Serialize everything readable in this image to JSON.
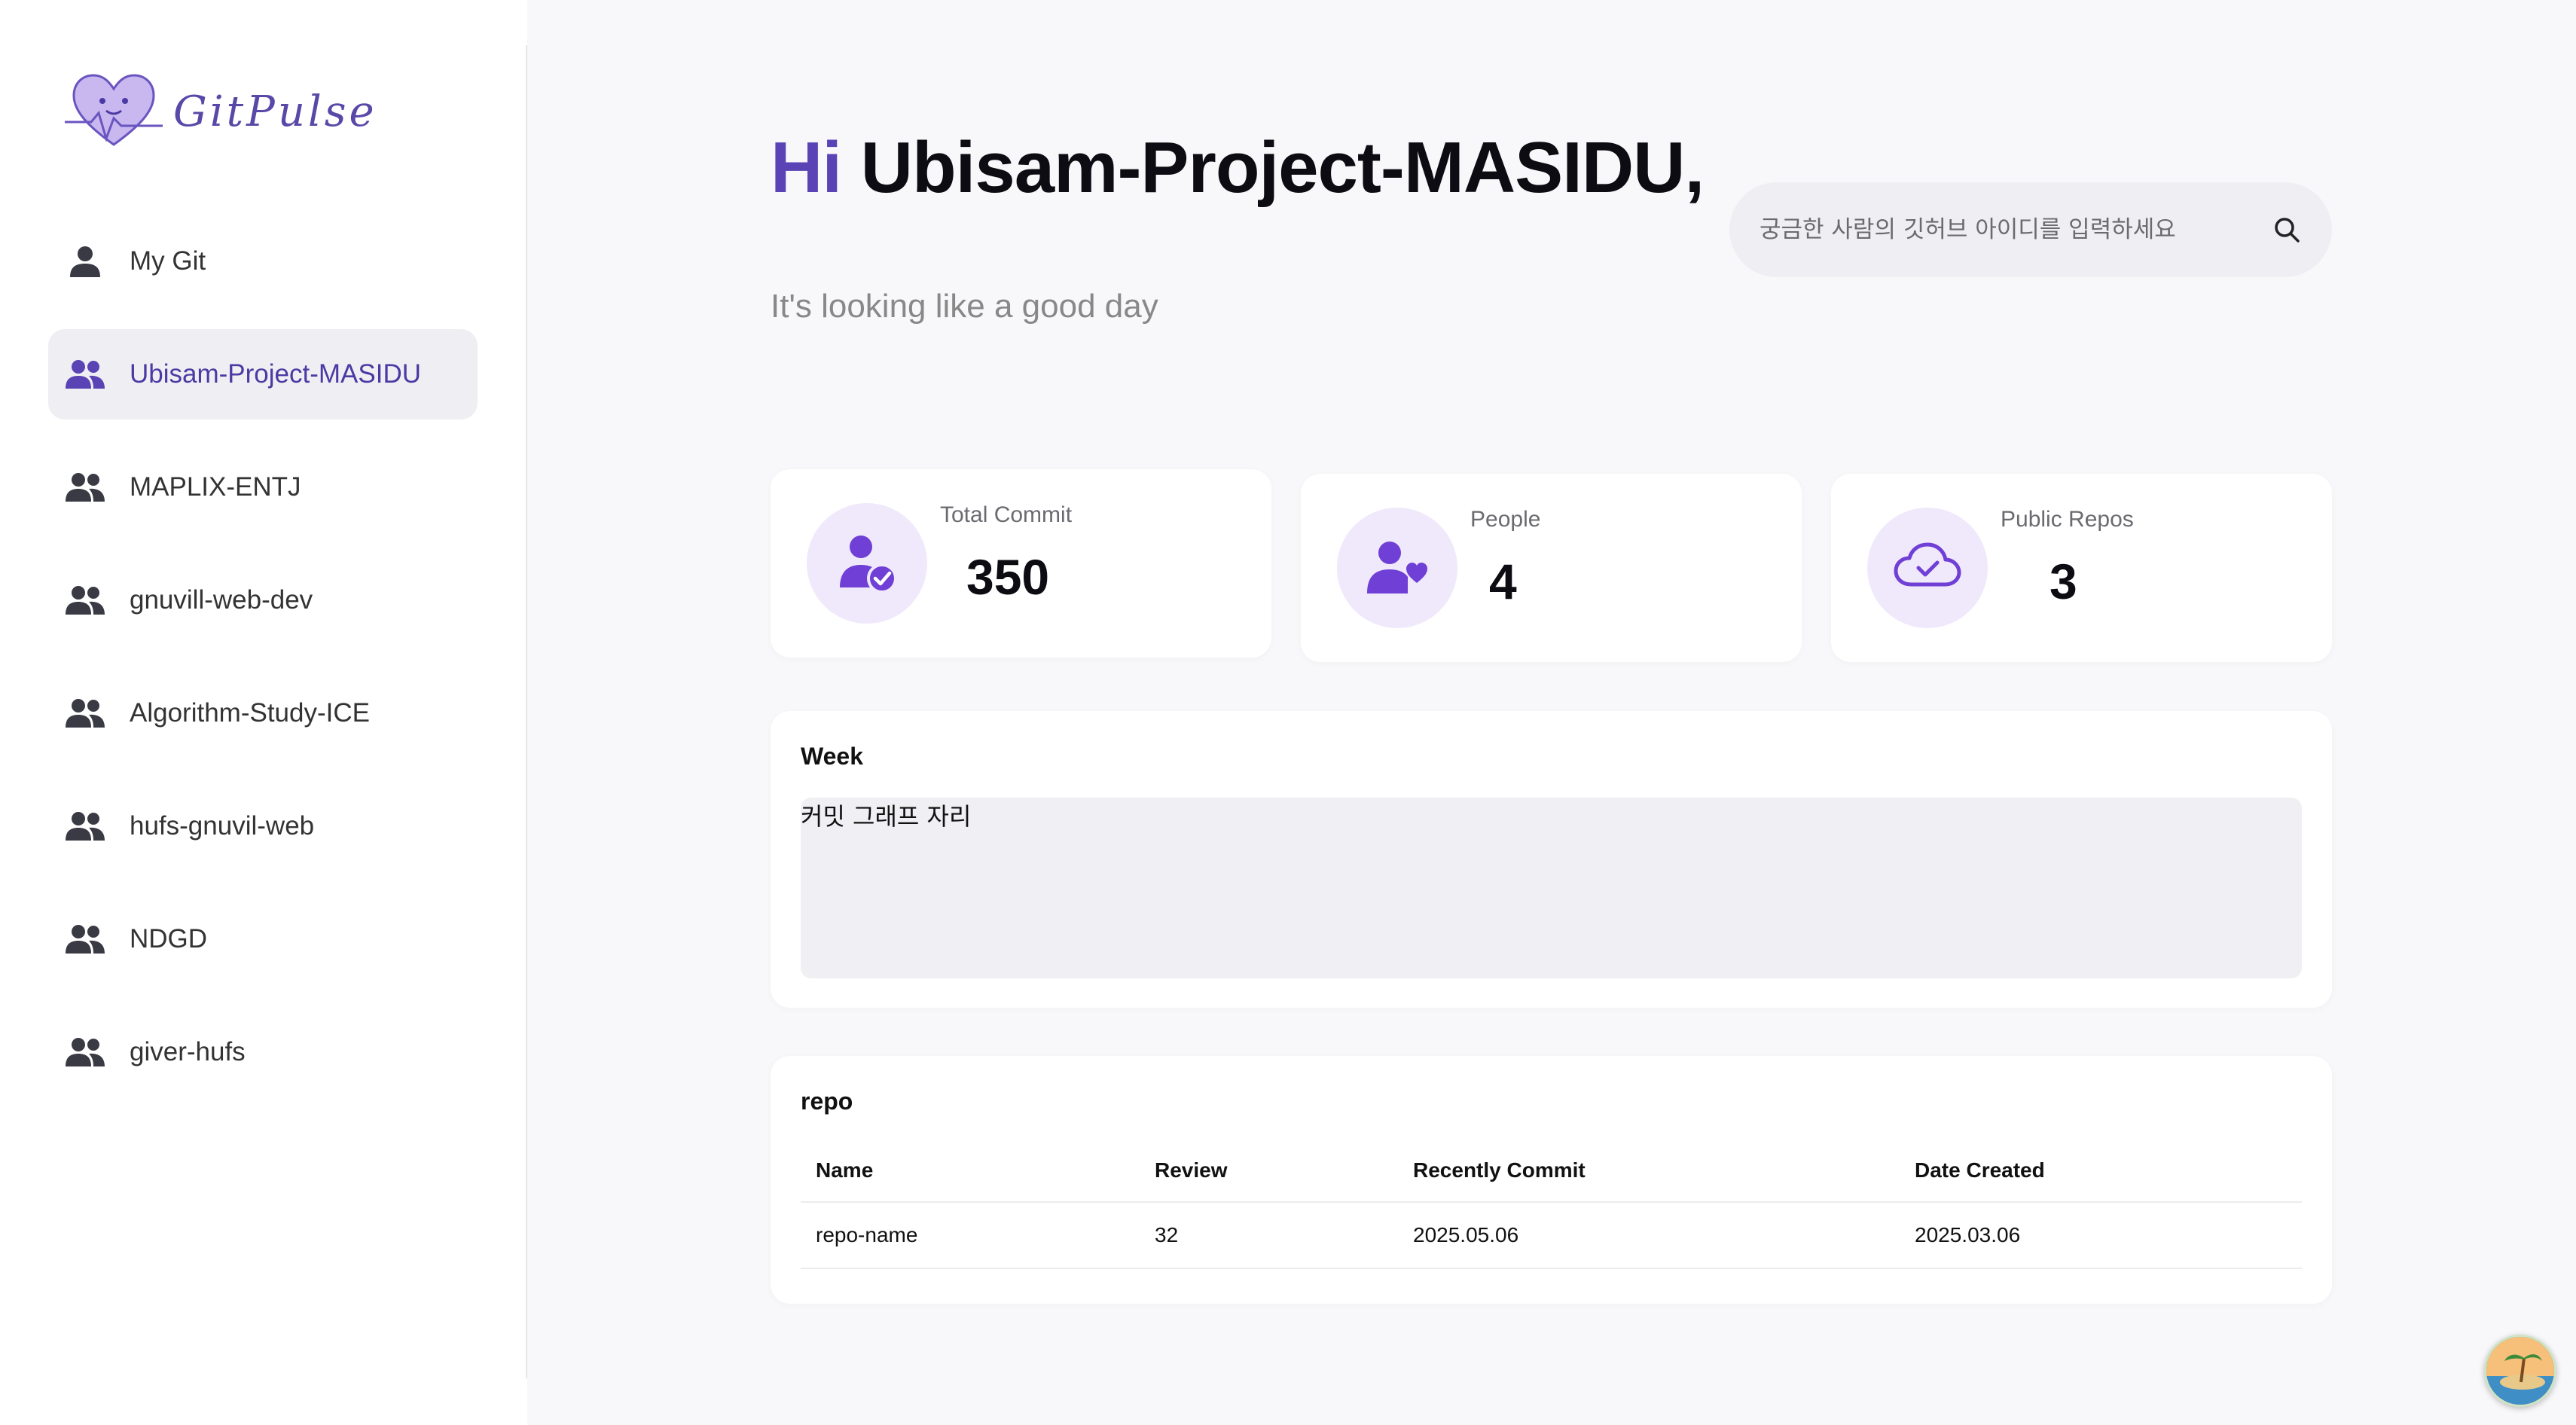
{
  "app": {
    "logo_text": "GitPulse"
  },
  "sidebar": {
    "items": [
      {
        "label": "My Git",
        "icon": "user-icon",
        "active": false
      },
      {
        "label": "Ubisam-Project-MASIDU",
        "icon": "users-icon",
        "active": true
      },
      {
        "label": "MAPLIX-ENTJ",
        "icon": "users-icon",
        "active": false
      },
      {
        "label": "gnuvill-web-dev",
        "icon": "users-icon",
        "active": false
      },
      {
        "label": "Algorithm-Study-ICE",
        "icon": "users-icon",
        "active": false
      },
      {
        "label": "hufs-gnuvil-web",
        "icon": "users-icon",
        "active": false
      },
      {
        "label": "NDGD",
        "icon": "users-icon",
        "active": false
      },
      {
        "label": "giver-hufs",
        "icon": "users-icon",
        "active": false
      }
    ]
  },
  "header": {
    "greeting_hi": "Hi",
    "greeting_name": "Ubisam-Project-MASIDU,",
    "subtitle": "It's looking like a good day"
  },
  "search": {
    "placeholder": "궁금한 사람의 깃허브 아이디를 입력하세요",
    "value": ""
  },
  "stats": {
    "total_commit": {
      "label": "Total Commit",
      "value": "350",
      "icon": "user-check-icon"
    },
    "people": {
      "label": "People",
      "value": "4",
      "icon": "user-heart-icon"
    },
    "public_repos": {
      "label": "Public Repos",
      "value": "3",
      "icon": "cloud-check-icon"
    }
  },
  "week": {
    "title": "Week",
    "placeholder_text": "커밋 그래프 자리"
  },
  "repo": {
    "title": "repo",
    "columns": [
      "Name",
      "Review",
      "Recently Commit",
      "Date Created"
    ],
    "rows": [
      [
        "repo-name",
        "32",
        "2025.05.06",
        "2025.03.06"
      ]
    ]
  },
  "colors": {
    "accent": "#5a43b5",
    "accent_light": "#efe9fb",
    "sidebar_active_bg": "#efeff3",
    "page_bg": "#f8f8fa"
  }
}
